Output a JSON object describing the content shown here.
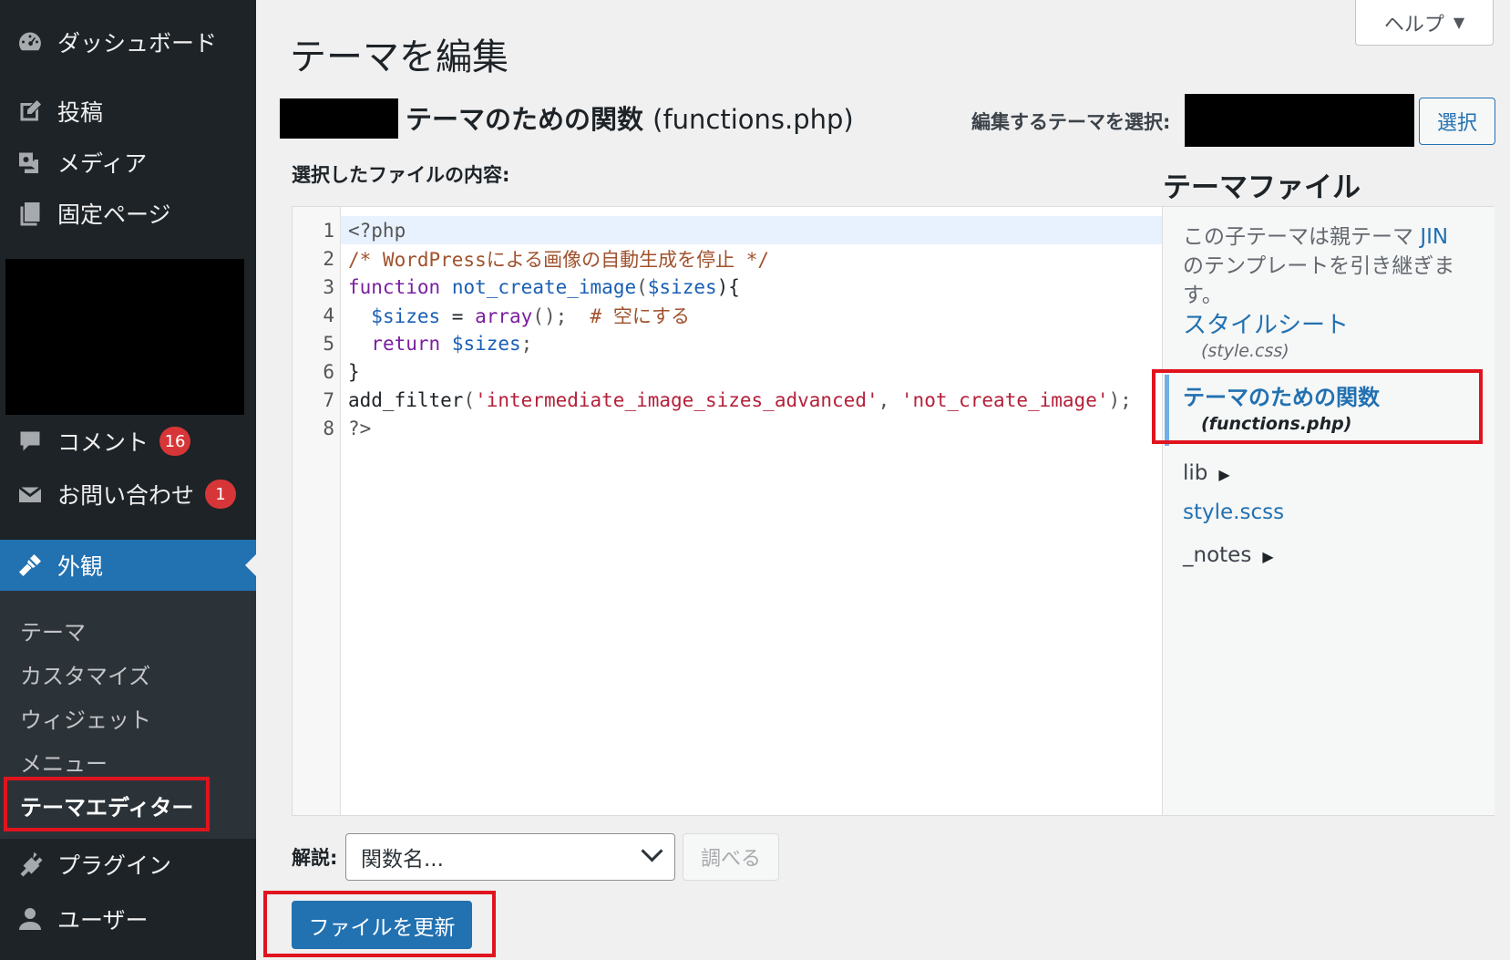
{
  "sidebar": {
    "items": [
      {
        "label": "ダッシュボード",
        "icon": "dashboard-icon"
      },
      {
        "label": "投稿",
        "icon": "post-icon"
      },
      {
        "label": "メディア",
        "icon": "media-icon"
      },
      {
        "label": "固定ページ",
        "icon": "page-icon"
      },
      {
        "label": "コメント",
        "icon": "comment-icon",
        "badge": "16"
      },
      {
        "label": "お問い合わせ",
        "icon": "mail-icon",
        "badge": "1"
      },
      {
        "label": "外観",
        "icon": "appearance-icon"
      },
      {
        "label": "プラグイン",
        "icon": "plugin-icon"
      },
      {
        "label": "ユーザー",
        "icon": "user-icon"
      }
    ],
    "submenu": [
      "テーマ",
      "カスタマイズ",
      "ウィジェット",
      "メニュー",
      "テーマエディター"
    ]
  },
  "header": {
    "help_label": "ヘルプ",
    "page_title": "テーマを編集",
    "file_heading": "テーマのための関数",
    "file_heading_name": "(functions.php)",
    "select_theme_label": "編集するテーマを選択:",
    "select_button": "選択",
    "content_label": "選択したファイルの内容:"
  },
  "editor": {
    "line_numbers": [
      "1",
      "2",
      "3",
      "4",
      "5",
      "6",
      "7",
      "8"
    ],
    "lines": {
      "l1": "<?php",
      "l2": "/* WordPressによる画像の自動生成を停止 */",
      "l3_kw": "function",
      "l3_fn": "not_create_image",
      "l3_open": "(",
      "l3_var": "$sizes",
      "l3_close": "){",
      "l4_var": "$sizes",
      "l4_eq": " = ",
      "l4_kw": "array",
      "l4_call": "();  ",
      "l4_comment": "# 空にする",
      "l5_kw": "return",
      "l5_var": "$sizes",
      "l5_end": ";",
      "l6": "}",
      "l7_fn": "add_filter",
      "l7_open": "(",
      "l7_str1": "'intermediate_image_sizes_advanced'",
      "l7_sep": ", ",
      "l7_str2": "'not_create_image'",
      "l7_close": ");",
      "l8": "?>"
    }
  },
  "files": {
    "title": "テーマファイル",
    "note_before": "この子テーマは親テーマ ",
    "note_link": "JIN",
    "note_after": " のテンプレートを引き継ぎます。",
    "stylesheet_label": "スタイルシート",
    "stylesheet_file": "(style.css)",
    "current_label": "テーマのための関数",
    "current_file": "(functions.php)",
    "folder_lib": "lib",
    "style_scss": "style.scss",
    "folder_notes": "_notes"
  },
  "footer": {
    "doc_label": "解説:",
    "doc_select_value": "関数名...",
    "lookup_button": "調べる",
    "update_button": "ファイルを更新"
  },
  "colors": {
    "sidebar_bg": "#1d2327",
    "accent": "#2271b1",
    "badge": "#d63638",
    "highlight_box": "#e0141e"
  }
}
